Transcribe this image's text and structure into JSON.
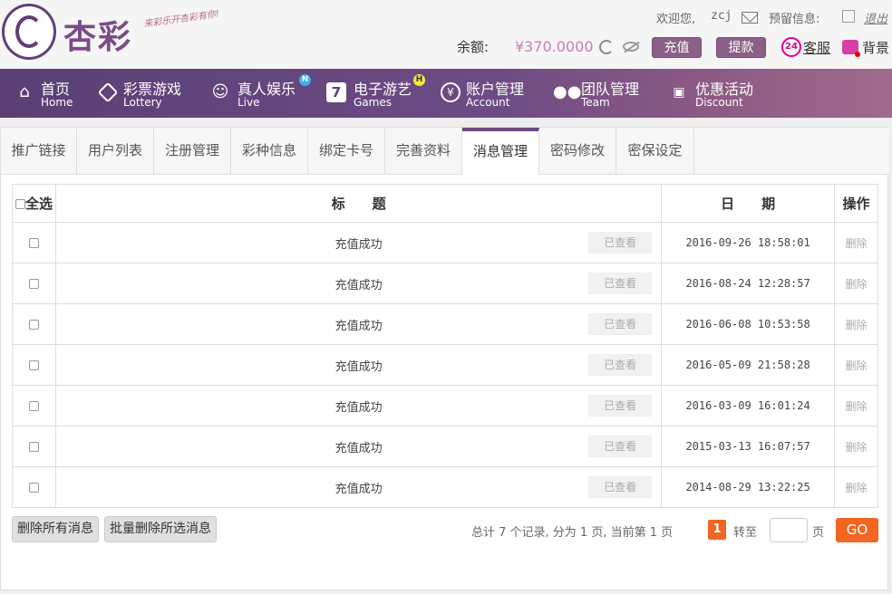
{
  "header": {
    "brand": "杏彩",
    "slogan": "来彩乐开杏彩有你!",
    "welcome": "欢迎您,",
    "username": "zcj",
    "reserved_info": "预留信息:",
    "logout": "退出",
    "balance_label": "余额:",
    "balance_value": "¥370.0000",
    "recharge": "充值",
    "withdraw": "提款",
    "service_badge": "24",
    "service": "客服",
    "background": "背景"
  },
  "nav": {
    "items": [
      {
        "cn": "首页",
        "en": "Home",
        "icon": "home-icon"
      },
      {
        "cn": "彩票游戏",
        "en": "Lottery",
        "icon": "lottery-icon"
      },
      {
        "cn": "真人娱乐",
        "en": "Live",
        "icon": "live-icon",
        "badge": "N"
      },
      {
        "cn": "电子游艺",
        "en": "Games",
        "icon": "games-icon",
        "badge": "H"
      },
      {
        "cn": "账户管理",
        "en": "Account",
        "icon": "account-icon"
      },
      {
        "cn": "团队管理",
        "en": "Team",
        "icon": "team-icon"
      },
      {
        "cn": "优惠活动",
        "en": "Discount",
        "icon": "gift-icon"
      }
    ]
  },
  "tabs": [
    "推广链接",
    "用户列表",
    "注册管理",
    "彩种信息",
    "绑定卡号",
    "完善资料",
    "消息管理",
    "密码修改",
    "密保设定"
  ],
  "active_tab": "消息管理",
  "table": {
    "headers": {
      "select_all": "全选",
      "title": "标　　题",
      "date": "日　　期",
      "action": "操作"
    },
    "view_label": "已查看",
    "delete_label": "删除",
    "rows": [
      {
        "title": "充值成功",
        "date": "2016-09-26 18:58:01"
      },
      {
        "title": "充值成功",
        "date": "2016-08-24 12:28:57"
      },
      {
        "title": "充值成功",
        "date": "2016-06-08 10:53:58"
      },
      {
        "title": "充值成功",
        "date": "2016-05-09 21:58:28"
      },
      {
        "title": "充值成功",
        "date": "2016-03-09 16:01:24"
      },
      {
        "title": "充值成功",
        "date": "2015-03-13 16:07:57"
      },
      {
        "title": "充值成功",
        "date": "2014-08-29 13:22:25"
      }
    ]
  },
  "footer": {
    "delete_all": "删除所有消息",
    "delete_selected": "批量删除所选消息",
    "summary": "总计 7 个记录, 分为 1 页, 当前第 1 页",
    "current_page": "1",
    "goto_label": "转至",
    "page_unit": "页",
    "go": "GO"
  },
  "colors": {
    "nav_purple": "#5a3f74",
    "accent_orange": "#f26522",
    "button_purple": "#8b5f87"
  }
}
